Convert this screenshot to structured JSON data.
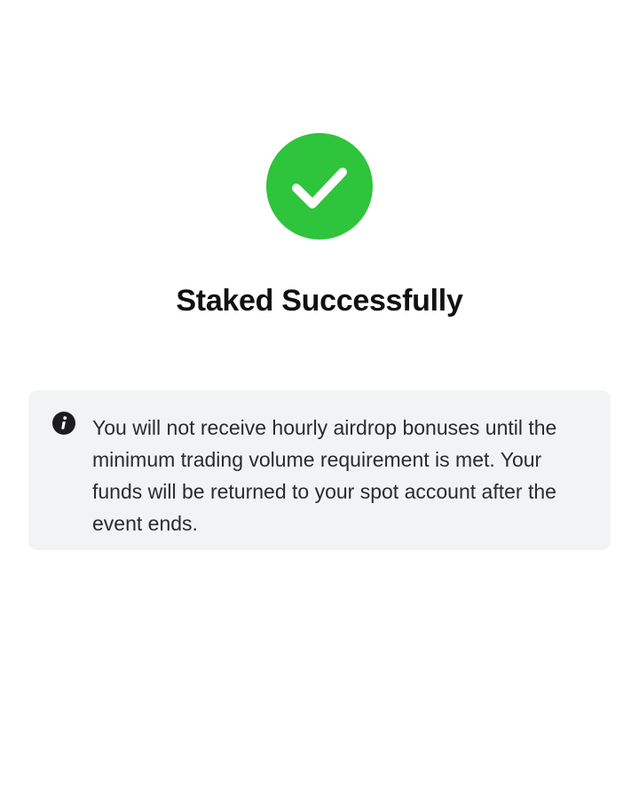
{
  "status": {
    "title": "Staked Successfully",
    "icon": "check-circle-icon",
    "accent_color": "#2ec43b"
  },
  "notice": {
    "icon": "info-icon",
    "message": "You will not receive hourly airdrop bonuses until the minimum trading volume requirement is met. Your funds will be returned to your spot account after the event ends."
  }
}
